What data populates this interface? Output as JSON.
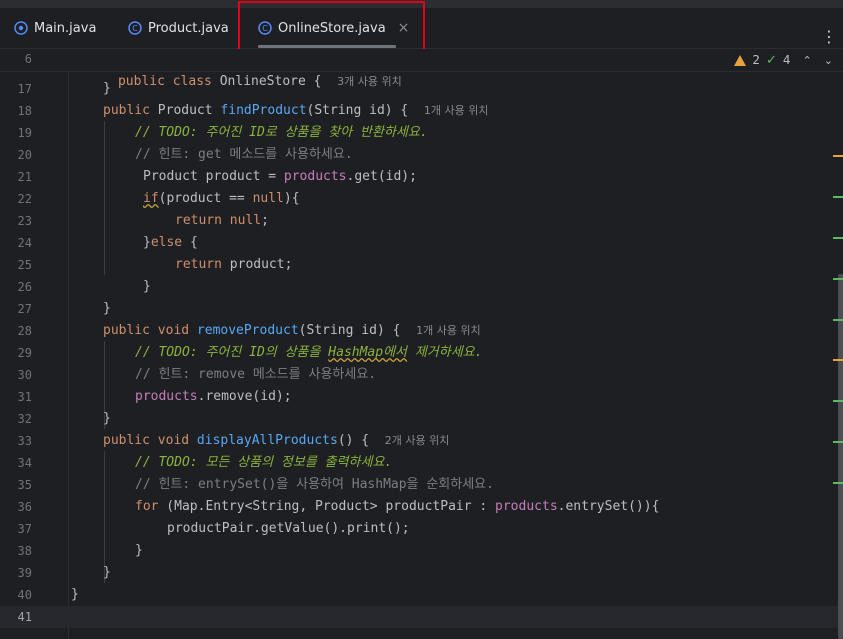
{
  "tabs": [
    {
      "label": "Main.java",
      "icon": "java-class-run-icon",
      "active": false
    },
    {
      "label": "Product.java",
      "icon": "java-class-icon",
      "active": false
    },
    {
      "label": "OnlineStore.java",
      "icon": "java-class-icon",
      "active": true,
      "close": "×"
    }
  ],
  "menu_icon": "⋮",
  "sticky": {
    "line": "6",
    "kw": "public class",
    "name": " OnlineStore {",
    "hint": "3개 사용 위치"
  },
  "inspections": {
    "warnings": "2",
    "ok": "4",
    "up": "⌃",
    "down": "⌄"
  },
  "lines": [
    "17",
    "18",
    "19",
    "20",
    "21",
    "22",
    "23",
    "24",
    "25",
    "26",
    "27",
    "28",
    "29",
    "30",
    "31",
    "32",
    "33",
    "34",
    "35",
    "36",
    "37",
    "38",
    "39",
    "40",
    "41"
  ],
  "code": {
    "l17": "}",
    "l18_kw": "public",
    "l18_type": " Product ",
    "l18_fn": "findProduct",
    "l18_rest": "(String id) {",
    "l18_hint": "1개 사용 위치",
    "l19": "// TODO: 주어진 ID로 상품을 찾아 반환하세요.",
    "l20": "// 힌트: get 메소드를 사용하세요.",
    "l21_a": "Product product = ",
    "l21_fld": "products",
    "l21_b": ".get(id);",
    "l22_kw": "if",
    "l22_a": "(product == ",
    "l22_null": "null",
    "l22_b": "){",
    "l23_kw": "return null",
    "l23_b": ";",
    "l24_a": "}",
    "l24_kw": "else",
    "l24_b": " {",
    "l25_kw": "return",
    "l25_b": " product;",
    "l26": "}",
    "l27": "}",
    "l28_kw": "public void",
    "l28_fn": " removeProduct",
    "l28_rest": "(String id) {",
    "l28_hint": "1개 사용 위치",
    "l29_a": "// TODO: 주어진 ID의 상품을 ",
    "l29_w": "HashMap에서",
    "l29_b": " 제거하세요.",
    "l30": "// 힌트: remove 메소드를 사용하세요.",
    "l31_fld": "products",
    "l31_b": ".remove(id);",
    "l32": "}",
    "l33_kw": "public void",
    "l33_fn": " displayAllProducts",
    "l33_rest": "() {",
    "l33_hint": "2개 사용 위치",
    "l34": "// TODO: 모든 상품의 정보를 출력하세요.",
    "l35_a": "// 힌트: entrySet()을 사용하여 HashMap을 순회하세요.",
    "l36_kw": "for",
    "l36_a": " (Map.Entry<String, Product> productPair : ",
    "l36_fld": "products",
    "l36_b": ".entrySet()){",
    "l37": "productPair.getValue().print();",
    "l38": "}",
    "l39": "}",
    "l40": "}"
  },
  "colors": {
    "accent_box": "#e2001a",
    "todo": "#8bb33d",
    "keyword": "#cf8e6d",
    "function": "#56a8f5",
    "field": "#c77dbb"
  }
}
